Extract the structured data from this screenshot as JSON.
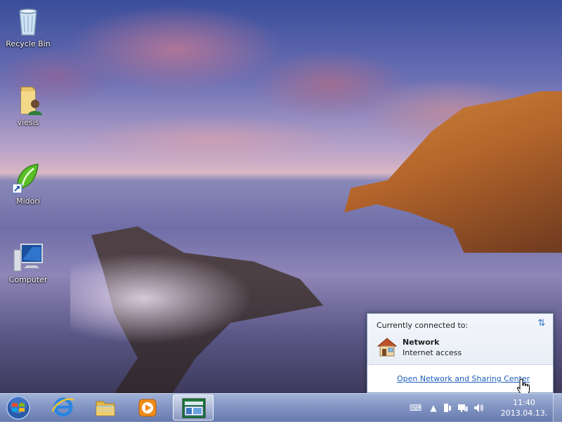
{
  "desktop": {
    "icons": [
      {
        "label": "Recycle Bin",
        "icon": "recycle-bin-icon"
      },
      {
        "label": "viesis",
        "icon": "user-folder-icon"
      },
      {
        "label": "Midori",
        "icon": "midori-browser-icon"
      },
      {
        "label": "Computer",
        "icon": "computer-icon"
      }
    ]
  },
  "network_flyout": {
    "header": "Currently connected to:",
    "network_name": "Network",
    "network_status": "Internet access",
    "open_link": "Open Network and Sharing Center",
    "icons": {
      "network": "home-network-icon",
      "refresh": "refresh-arrows-icon"
    }
  },
  "taskbar": {
    "start_icon": "windows-start-orb-icon",
    "pinned": [
      {
        "name": "Internet Explorer",
        "icon": "internet-explorer-icon"
      },
      {
        "name": "Windows Explorer",
        "icon": "folder-explorer-icon"
      },
      {
        "name": "Windows Media Player",
        "icon": "media-player-icon"
      },
      {
        "name": "Running app",
        "icon": "app-window-icon",
        "active": true
      }
    ],
    "tray": {
      "icons": [
        "keyboard-icon",
        "show-hidden-arrow-icon",
        "action-center-icon",
        "network-icon",
        "volume-icon"
      ],
      "time": "11:40",
      "date": "2013.04.13."
    }
  },
  "colors": {
    "link": "#1f5fbf",
    "taskbar": "#7b8cc2",
    "flyout_border": "#7f94b4"
  }
}
